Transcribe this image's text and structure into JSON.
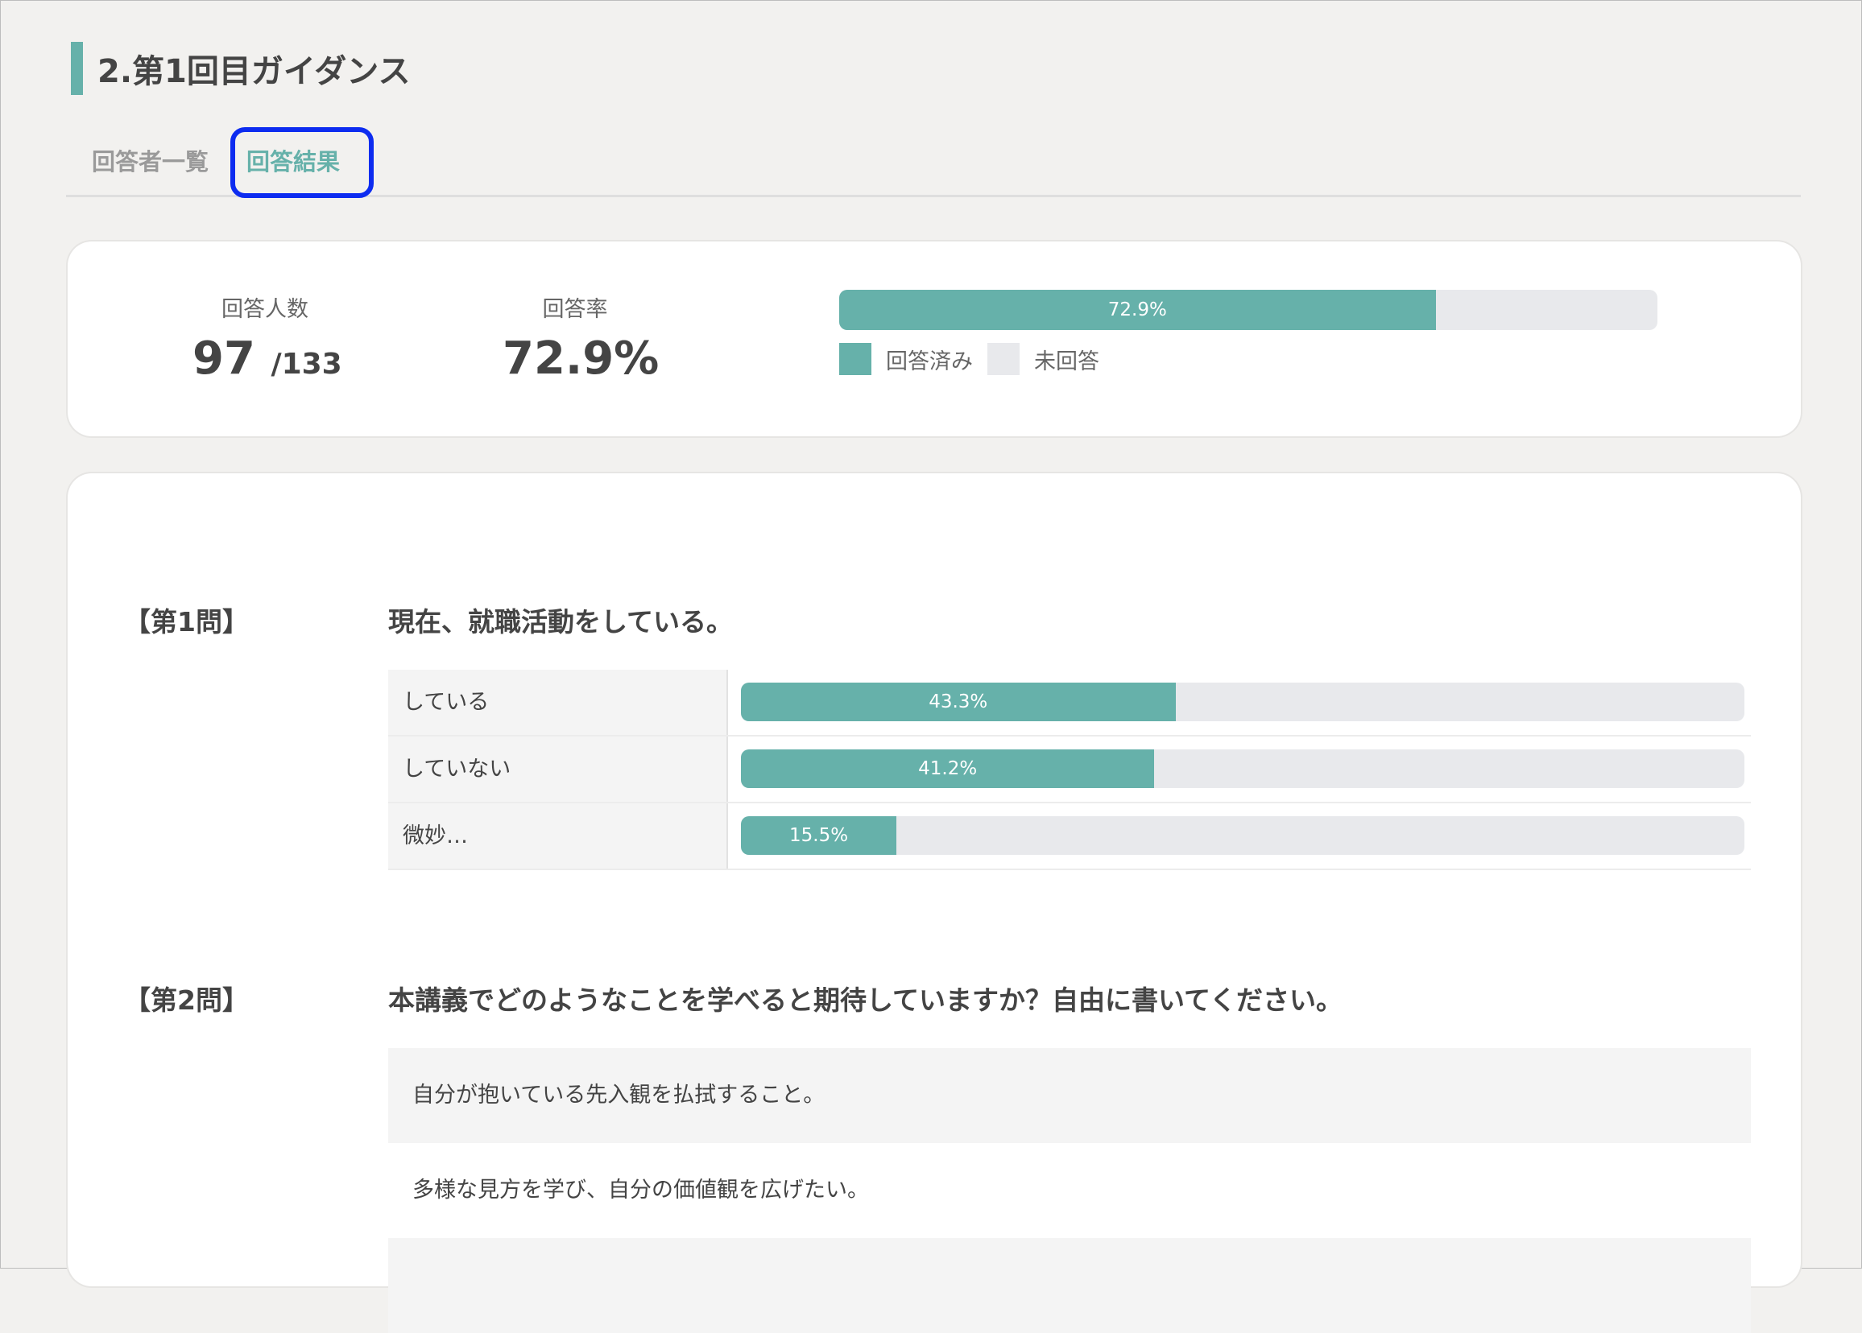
{
  "page": {
    "title": "2.第1回目ガイダンス"
  },
  "tabs": [
    {
      "label": "回答者一覧",
      "active": false
    },
    {
      "label": "回答結果",
      "active": true
    }
  ],
  "summary": {
    "respondents_label": "回答人数",
    "respondents_count": "97",
    "respondents_total": "/133",
    "rate_label": "回答率",
    "rate_value": "72.9%",
    "bar_value": 72.9,
    "bar_label": "72.9%",
    "legend_answered": "回答済み",
    "legend_unanswered": "未回答"
  },
  "questions": [
    {
      "number": "【第1問】",
      "text": "現在、就職活動をしている。",
      "choices": [
        {
          "label": "している",
          "percent": 43.3,
          "percent_label": "43.3%"
        },
        {
          "label": "していない",
          "percent": 41.2,
          "percent_label": "41.2%"
        },
        {
          "label": "微妙…",
          "percent": 15.5,
          "percent_label": "15.5%"
        }
      ]
    },
    {
      "number": "【第2問】",
      "text": "本講義でどのようなことを学べると期待していますか？自由に書いてください。",
      "answers": [
        "自分が抱いている先入観を払拭すること。",
        "多様な見方を学び、自分の価値観を広げたい。",
        ""
      ]
    }
  ],
  "colors": {
    "accent": "#66b1aa",
    "track": "#e8e9ec",
    "highlight": "#0d2cf0"
  }
}
